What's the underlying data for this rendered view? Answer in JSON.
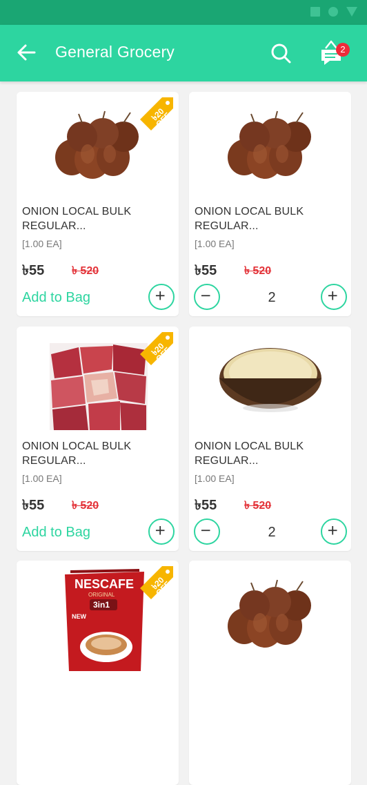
{
  "header": {
    "title": "General Grocery",
    "cart_count": "2",
    "accent_color": "#2dd5a0",
    "status_color": "#1aa673",
    "icons": {
      "back": "arrow-left-icon",
      "search": "search-icon",
      "cart": "cart-icon"
    }
  },
  "products": [
    {
      "name": "ONION LOCAL BULK REGULAR...",
      "unit": "[1.00 EA]",
      "price": "৳55",
      "old_price": "৳ 520",
      "discount": "৳20 OFF",
      "image": "onion",
      "action": "Add to Bag",
      "in_cart": false
    },
    {
      "name": "ONION LOCAL BULK REGULAR...",
      "unit": "[1.00 EA]",
      "price": "৳55",
      "old_price": "৳ 520",
      "discount": "",
      "image": "onion",
      "action": "",
      "in_cart": true,
      "quantity": "2"
    },
    {
      "name": "ONION LOCAL BULK REGULAR...",
      "unit": "[1.00 EA]",
      "price": "৳55",
      "old_price": "৳ 520",
      "discount": "৳20 OFF",
      "image": "meat",
      "action": "Add to Bag",
      "in_cart": false
    },
    {
      "name": "ONION LOCAL BULK REGULAR...",
      "unit": "[1.00 EA]",
      "price": "৳55",
      "old_price": "৳ 520",
      "discount": "",
      "image": "rice",
      "action": "",
      "in_cart": true,
      "quantity": "2"
    },
    {
      "name": "",
      "unit": "",
      "price": "",
      "old_price": "",
      "discount": "৳20 OFF",
      "image": "coffee",
      "action": "",
      "in_cart": false
    },
    {
      "name": "",
      "unit": "",
      "price": "",
      "old_price": "",
      "discount": "",
      "image": "onion",
      "action": "",
      "in_cart": false
    }
  ],
  "coffee_pack": {
    "brand": "NESCAFE",
    "sub": "ORIGINAL",
    "variant": "3in1",
    "badge": "NEW"
  }
}
